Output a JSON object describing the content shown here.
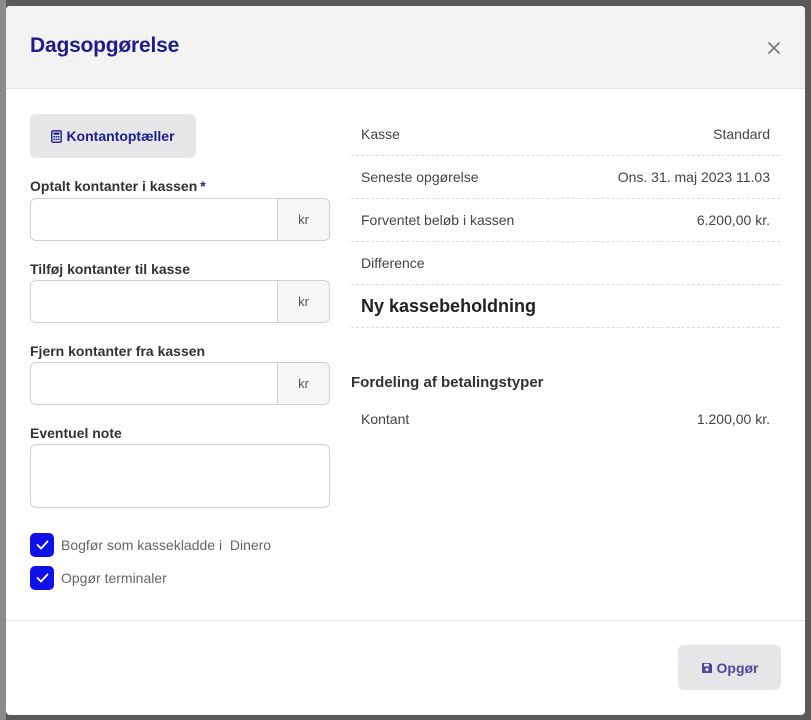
{
  "modal": {
    "title": "Dagsopgørelse",
    "close_icon": "close-icon"
  },
  "form": {
    "counter_button": {
      "icon": "calculator-icon",
      "label": "Kontantoptæller"
    },
    "fields": [
      {
        "label": "Optalt kontanter i kassen",
        "required_mark": "*",
        "value": "",
        "unit": "kr"
      },
      {
        "label": "Tilføj kontanter til kasse",
        "value": "",
        "unit": "kr"
      },
      {
        "label": "Fjern kontanter fra kassen",
        "value": "",
        "unit": "kr"
      }
    ],
    "note": {
      "label": "Eventuel note",
      "value": ""
    },
    "checkboxes": [
      {
        "label": "Bogfør som kassekladde i  Dinero",
        "checked": true
      },
      {
        "label": "Opgør terminaler",
        "checked": true
      }
    ]
  },
  "summary": {
    "rows": [
      {
        "key": "Kasse",
        "value": "Standard"
      },
      {
        "key": "Seneste opgørelse",
        "value": "Ons. 31. maj 2023 11.03"
      },
      {
        "key": "Forventet beløb i kassen",
        "value": "6.200,00 kr."
      },
      {
        "key": "Difference",
        "value": ""
      },
      {
        "key": "Ny kassebeholdning",
        "value": ""
      }
    ],
    "payment_section": {
      "title": "Fordeling af betalingstyper",
      "rows": [
        {
          "key": "Kontant",
          "value": "1.200,00 kr."
        }
      ]
    }
  },
  "footer": {
    "save_button": {
      "icon": "save-icon",
      "label": "Opgør"
    }
  },
  "colors": {
    "accent": "#1c1c8c",
    "checkbox": "#1010e8",
    "header_bg": "#f3f3f4",
    "button_bg": "#e6e6e9"
  }
}
